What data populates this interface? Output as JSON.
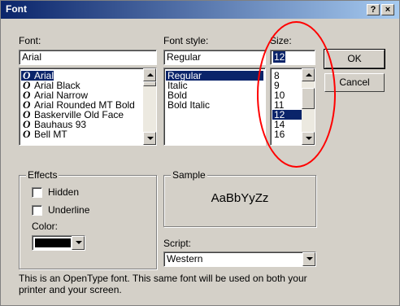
{
  "window": {
    "title": "Font",
    "help_label": "?",
    "close_label": "×"
  },
  "font": {
    "label": "Font:",
    "value": "Arial",
    "items": [
      {
        "name": "Arial",
        "selected": true
      },
      {
        "name": "Arial Black"
      },
      {
        "name": "Arial Narrow"
      },
      {
        "name": "Arial Rounded MT Bold"
      },
      {
        "name": "Baskerville Old Face"
      },
      {
        "name": "Bauhaus 93"
      },
      {
        "name": "Bell MT"
      }
    ]
  },
  "style": {
    "label": "Font style:",
    "value": "Regular",
    "items": [
      "Regular",
      "Italic",
      "Bold",
      "Bold Italic"
    ]
  },
  "size": {
    "label": "Size:",
    "value": "12",
    "items": [
      "8",
      "9",
      "10",
      "11",
      "12",
      "14",
      "16"
    ],
    "selected": "12"
  },
  "buttons": {
    "ok": "OK",
    "cancel": "Cancel"
  },
  "effects": {
    "title": "Effects",
    "hidden": "Hidden",
    "underline": "Underline",
    "color_label": "Color:",
    "color_value": "#000000"
  },
  "sample": {
    "title": "Sample",
    "text": "AaBbYyZz"
  },
  "script": {
    "label": "Script:",
    "value": "Western"
  },
  "description": {
    "line1": "This is an OpenType font. This same font will be used on both your",
    "line2": "printer and your screen."
  },
  "colors": {
    "title_start": "#0a246a",
    "title_end": "#a6caf0",
    "selection": "#0a246a",
    "face": "#d4d0c8",
    "annotation": "#ff0000"
  }
}
